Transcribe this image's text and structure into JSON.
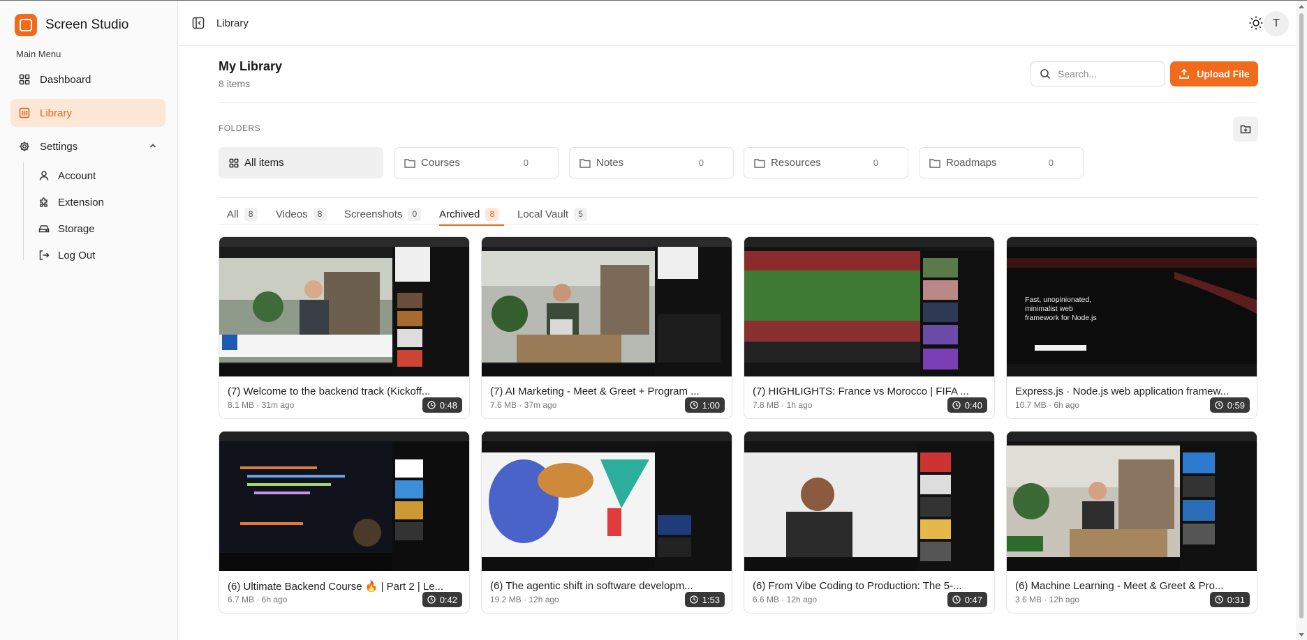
{
  "app": {
    "name": "Screen Studio",
    "accent": "#f26b1d"
  },
  "sidebar": {
    "menu_label": "Main Menu",
    "items": [
      {
        "label": "Dashboard",
        "icon": "dashboard-grid-icon"
      },
      {
        "label": "Library",
        "icon": "library-icon",
        "active": true
      },
      {
        "label": "Settings",
        "icon": "gear-icon",
        "expanded": true
      }
    ],
    "settings_children": [
      {
        "label": "Account",
        "icon": "user-icon"
      },
      {
        "label": "Extension",
        "icon": "puzzle-icon"
      },
      {
        "label": "Storage",
        "icon": "storage-drive-icon"
      },
      {
        "label": "Log Out",
        "icon": "logout-icon"
      }
    ]
  },
  "topbar": {
    "breadcrumb": "Library",
    "avatar_initial": "T"
  },
  "page": {
    "title": "My Library",
    "subtitle": "8 items",
    "search_placeholder": "Search...",
    "upload_label": "Upload File"
  },
  "folders": {
    "label": "FOLDERS",
    "all_label": "All items",
    "items": [
      {
        "name": "Courses",
        "count": "0"
      },
      {
        "name": "Notes",
        "count": "0"
      },
      {
        "name": "Resources",
        "count": "0"
      },
      {
        "name": "Roadmaps",
        "count": "0"
      }
    ]
  },
  "tabs": [
    {
      "label": "All",
      "count": "8"
    },
    {
      "label": "Videos",
      "count": "8"
    },
    {
      "label": "Screenshots",
      "count": "0"
    },
    {
      "label": "Archived",
      "count": "8",
      "active": true
    },
    {
      "label": "Local Vault",
      "count": "5"
    }
  ],
  "videos": [
    {
      "title": "(7) Welcome to the backend track (Kickoff...",
      "meta": "8.1 MB · 31m ago",
      "duration": "0:48"
    },
    {
      "title": "(7) AI Marketing - Meet & Greet + Program ...",
      "meta": "7.6 MB · 37m ago",
      "duration": "1:00"
    },
    {
      "title": "(7) HIGHLIGHTS: France vs Morocco | FIFA ...",
      "meta": "7.8 MB · 1h ago",
      "duration": "0:40"
    },
    {
      "title": "Express.js · Node.js web application framew...",
      "meta": "10.7 MB · 6h ago",
      "duration": "0:59"
    },
    {
      "title": "(6) Ultimate Backend Course 🔥 | Part 2 | Le...",
      "meta": "6.7 MB · 6h ago",
      "duration": "0:42"
    },
    {
      "title": "(6) The agentic shift in software developm...",
      "meta": "19.2 MB · 12h ago",
      "duration": "1:53"
    },
    {
      "title": "(6) From Vibe Coding to Production: The 5-...",
      "meta": "6.6 MB · 12h ago",
      "duration": "0:47"
    },
    {
      "title": "(6) Machine Learning - Meet & Greet & Pro...",
      "meta": "3.6 MB · 12h ago",
      "duration": "0:31"
    }
  ],
  "thumbnail_text": {
    "express_tagline": "Fast, unopinionated, minimalist web framework for Node.js"
  }
}
